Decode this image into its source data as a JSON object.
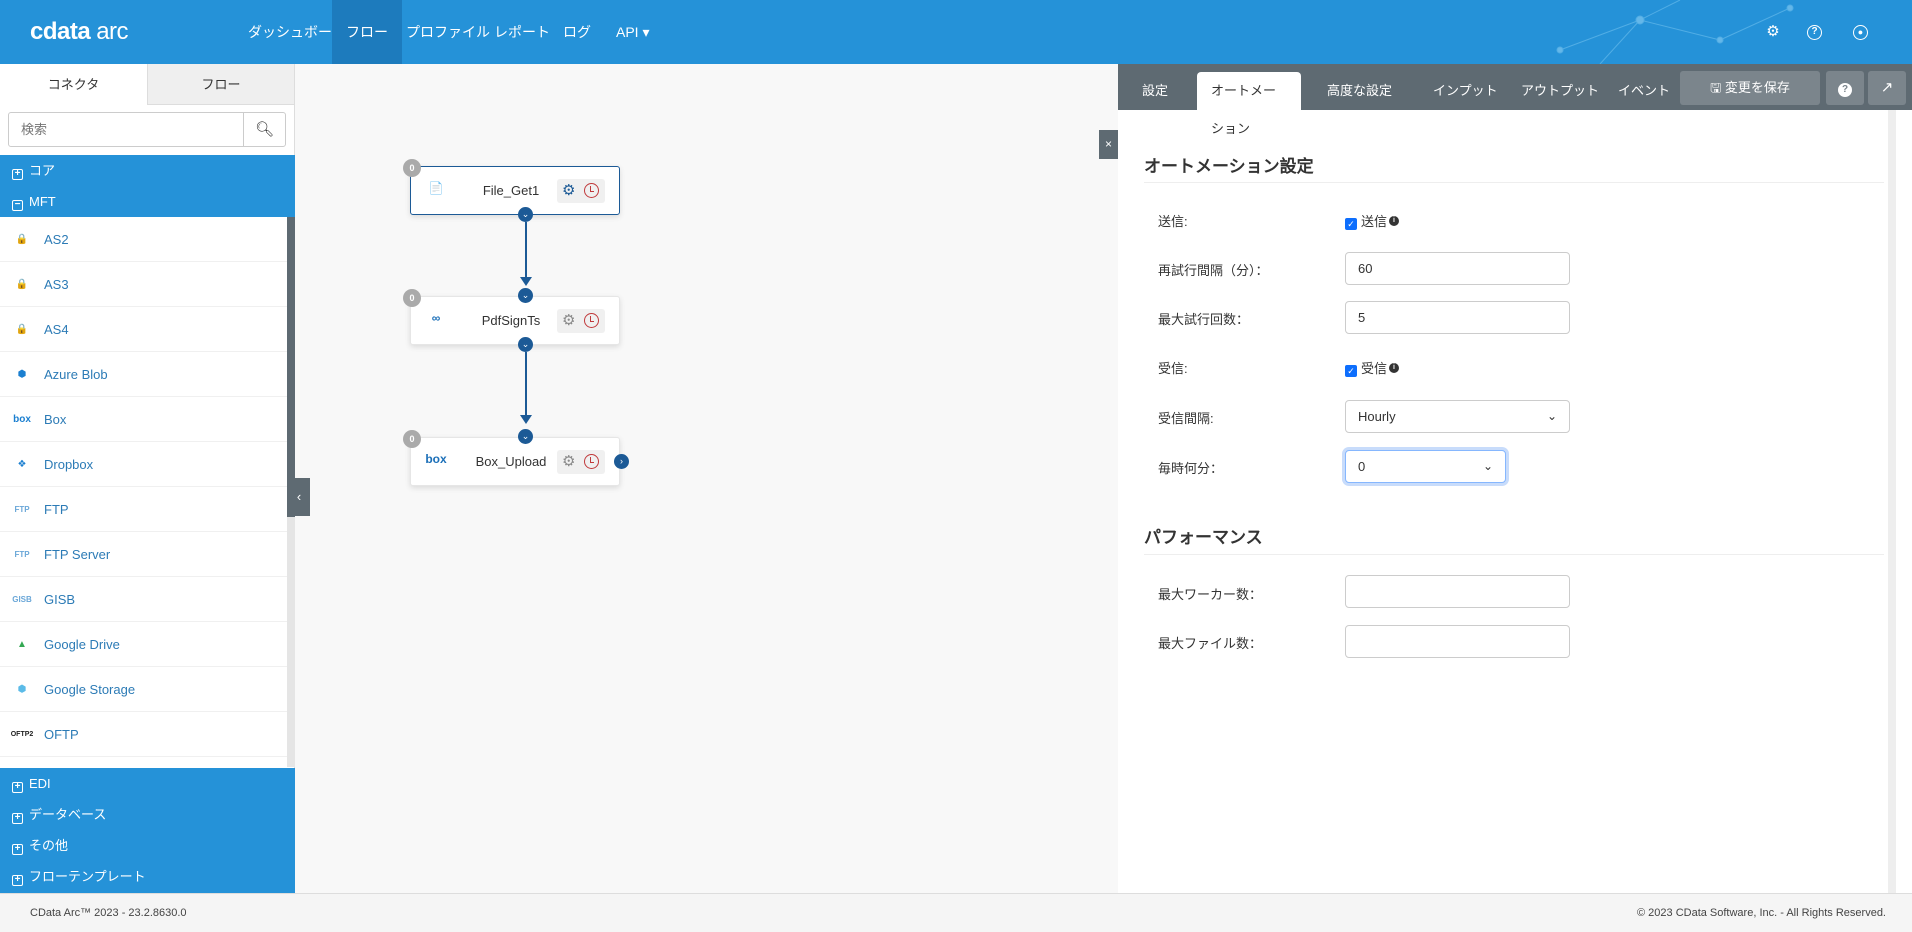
{
  "app": {
    "logo_bold": "cdata",
    "logo_light": "arc"
  },
  "nav": [
    "ダッシュボード",
    "フロー",
    "プロファイル",
    "レポート",
    "ログ",
    "API ▾"
  ],
  "nav_active": 1,
  "sidebar": {
    "tabs": [
      "コネクタ",
      "フロー"
    ],
    "search_placeholder": "検索",
    "categories_top": [
      "コア",
      "MFT"
    ],
    "mft_items": [
      {
        "label": "AS2",
        "icon": "as2-icon",
        "glyph": "🔒"
      },
      {
        "label": "AS3",
        "icon": "as3-icon",
        "glyph": "🔒"
      },
      {
        "label": "AS4",
        "icon": "as4-icon",
        "glyph": "🔒"
      },
      {
        "label": "Azure Blob",
        "icon": "azure-blob-icon",
        "glyph": "⬢"
      },
      {
        "label": "Box",
        "icon": "box-icon",
        "glyph": "box"
      },
      {
        "label": "Dropbox",
        "icon": "dropbox-icon",
        "glyph": "❖"
      },
      {
        "label": "FTP",
        "icon": "ftp-icon",
        "glyph": "FTP"
      },
      {
        "label": "FTP Server",
        "icon": "ftp-server-icon",
        "glyph": "FTP"
      },
      {
        "label": "GISB",
        "icon": "gisb-icon",
        "glyph": "GISB"
      },
      {
        "label": "Google Drive",
        "icon": "google-drive-icon",
        "glyph": "▲"
      },
      {
        "label": "Google Storage",
        "icon": "google-storage-icon",
        "glyph": "⬢"
      },
      {
        "label": "OFTP",
        "icon": "oftp-icon",
        "glyph": "OFTP2"
      }
    ],
    "categories_bottom": [
      "EDI",
      "データベース",
      "その他",
      "フローテンプレート"
    ]
  },
  "flow": {
    "nodes": [
      {
        "name": "File_Get1",
        "icon": "file-icon",
        "glyph": "📄",
        "badge": "0",
        "selected": true
      },
      {
        "name": "PdfSignTs",
        "icon": "pdfsign-icon",
        "glyph": "∞",
        "badge": "0",
        "selected": false
      },
      {
        "name": "Box_Upload",
        "icon": "box-icon",
        "glyph": "box",
        "badge": "0",
        "selected": false
      }
    ]
  },
  "panel": {
    "tabs": [
      "設定",
      "オートメーション",
      "高度な設定",
      "インプット",
      "アウトプット",
      "イベント"
    ],
    "active_tab": 1,
    "save_label": "🖫 変更を保存",
    "section1": "オートメーション設定",
    "send_label": "送信:",
    "send_checkbox": "送信",
    "retry_label": "再試行間隔（分）：",
    "retry_value": "60",
    "max_retry_label": "最大試行回数：",
    "max_retry_value": "5",
    "receive_label": "受信:",
    "receive_checkbox": "受信",
    "interval_label": "受信間隔:",
    "interval_value": "Hourly",
    "minute_label": "毎時何分：",
    "minute_value": "0",
    "section2": "パフォーマンス",
    "workers_label": "最大ワーカー数：",
    "workers_value": "",
    "files_label": "最大ファイル数：",
    "files_value": ""
  },
  "footer": {
    "left": "CData Arc™ 2023 - 23.2.8630.0",
    "right": "© 2023 CData Software, Inc. - All Rights Reserved."
  }
}
